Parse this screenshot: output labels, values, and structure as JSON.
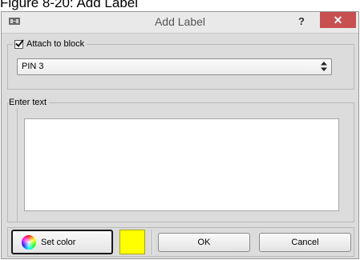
{
  "caption": "Figure 8-20: Add Label",
  "window": {
    "title": "Add Label",
    "help_label": "?",
    "close_label": "✕",
    "app_icon": "dialog-app-icon"
  },
  "attach_group": {
    "checkbox_label": "Attach to block",
    "checked": true,
    "block_select_value": "PIN 3"
  },
  "text_group": {
    "label": "Enter text",
    "value": ""
  },
  "buttons": {
    "set_color": "Set color",
    "ok": "OK",
    "cancel": "Cancel"
  },
  "colors": {
    "selected_color": "#ffff00",
    "close_button": "#c75050",
    "dialog_background": "#dcdcdc"
  },
  "icons": {
    "set_color_icon": "color-wheel-icon",
    "select_arrow_icon": "up-down-arrows-icon",
    "checkbox_icon": "checkmark-icon"
  }
}
